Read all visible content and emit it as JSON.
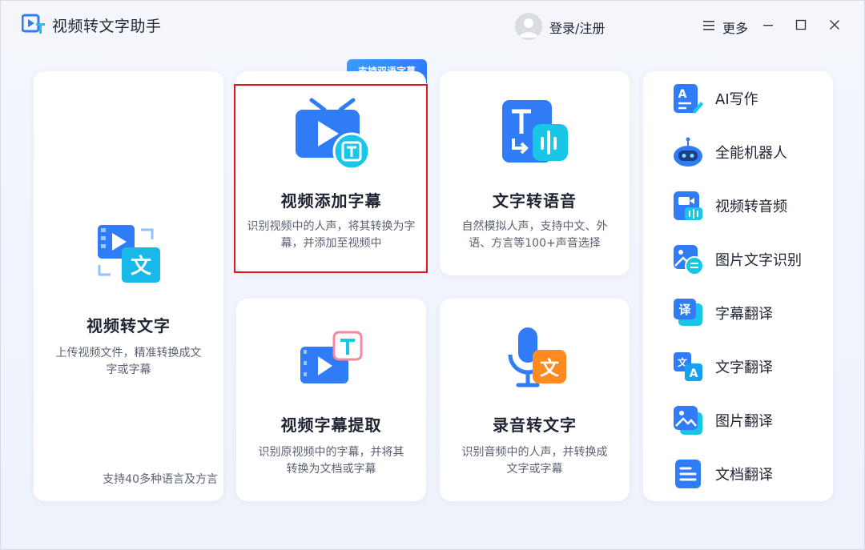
{
  "app": {
    "title": "视频转文字助手",
    "login": "登录/注册",
    "more": "更多"
  },
  "colors": {
    "accent": "#2f7cf6",
    "accent_light": "#3a9bff",
    "cyan": "#18c7e8",
    "orange": "#ff8a1f",
    "highlight": "#e1161e"
  },
  "cards": {
    "video_to_text": {
      "title": "视频转文字",
      "desc_line1": "上传视频文件，精准转换成文",
      "desc_line2": "字或字幕",
      "footer": "支持40多种语言及方言"
    },
    "add_subtitles": {
      "badge": "支持双语字幕",
      "title": "视频添加字幕",
      "desc_line1": "识别视频中的人声，将其转换为字",
      "desc_line2": "幕，并添加至视频中"
    },
    "tts": {
      "title": "文字转语音",
      "desc_line1": "自然模拟人声，支持中文、外",
      "desc_line2": "语、方言等100+声音选择"
    },
    "extract_subtitles": {
      "title": "视频字幕提取",
      "desc_line1": "识别原视频中的字幕，并将其",
      "desc_line2": "转换为文档或字幕"
    },
    "record_to_text": {
      "title": "录音转文字",
      "desc_line1": "识别音频中的人声，并转换成",
      "desc_line2": "文字或字幕"
    }
  },
  "tools": [
    {
      "label": "AI写作",
      "icon": "ai-writing-icon"
    },
    {
      "label": "全能机器人",
      "icon": "robot-icon"
    },
    {
      "label": "视频转音频",
      "icon": "video-to-audio-icon"
    },
    {
      "label": "图片文字识别",
      "icon": "image-ocr-icon"
    },
    {
      "label": "字幕翻译",
      "icon": "subtitle-translate-icon"
    },
    {
      "label": "文字翻译",
      "icon": "text-translate-icon"
    },
    {
      "label": "图片翻译",
      "icon": "image-translate-icon"
    },
    {
      "label": "文档翻译",
      "icon": "document-translate-icon"
    }
  ]
}
